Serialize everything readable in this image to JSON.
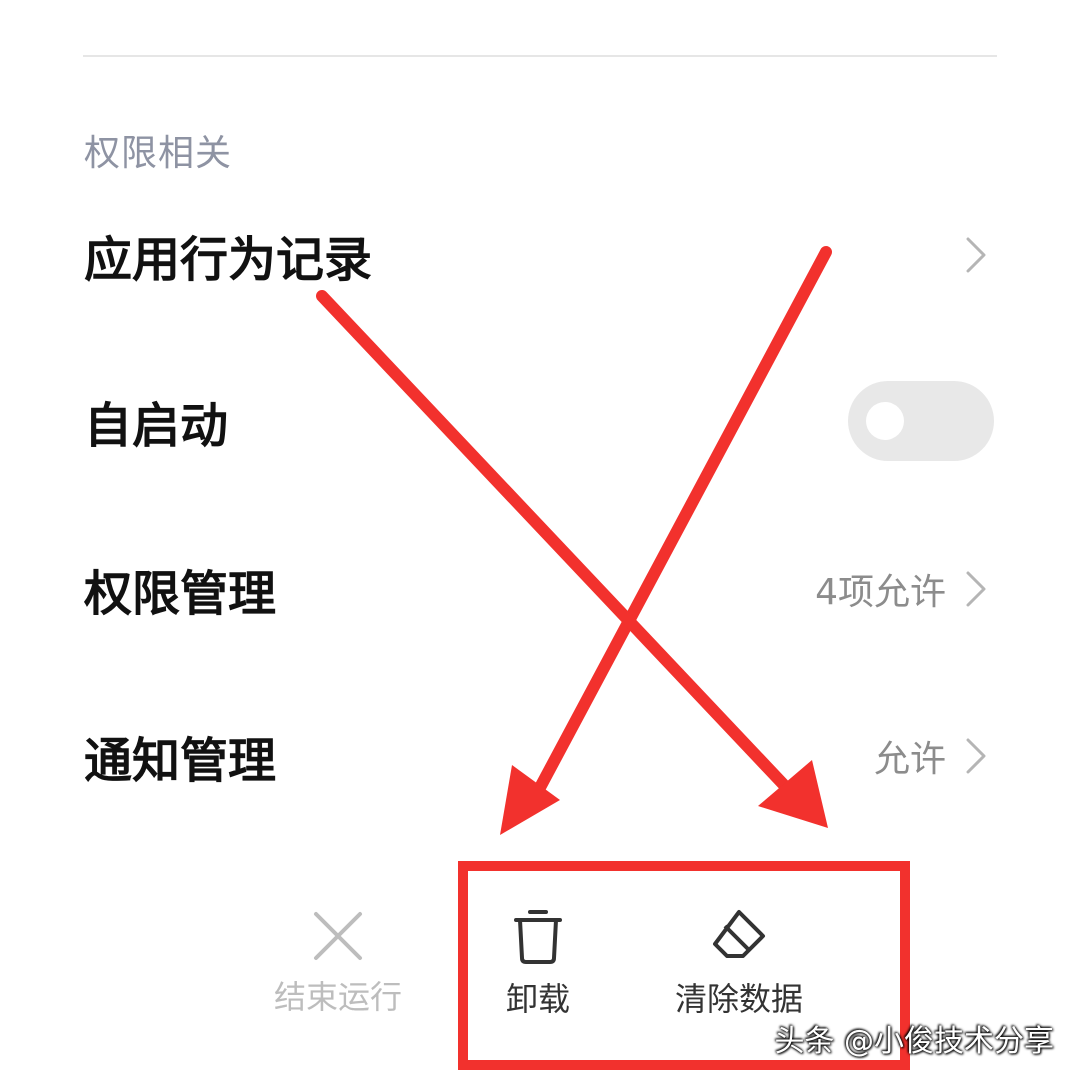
{
  "section": {
    "title": "权限相关"
  },
  "rows": [
    {
      "label": "应用行为记录",
      "value": ""
    },
    {
      "label": "自启动",
      "toggle_on": false
    },
    {
      "label": "权限管理",
      "value": "4项允许"
    },
    {
      "label": "通知管理",
      "value": "允许"
    }
  ],
  "bottom_actions": [
    {
      "label": "结束运行",
      "icon": "close-icon",
      "enabled": false
    },
    {
      "label": "卸载",
      "icon": "trash-icon",
      "enabled": true
    },
    {
      "label": "清除数据",
      "icon": "eraser-icon",
      "enabled": true
    }
  ],
  "annotation": {
    "color": "#f2312d"
  },
  "watermark": "头条 @小俊技术分享",
  "colors": {
    "section_title": "#8e93a3",
    "row_label": "#111111",
    "row_value": "#8c8c8c",
    "disabled": "#bdbdbd",
    "enabled": "#333333"
  }
}
